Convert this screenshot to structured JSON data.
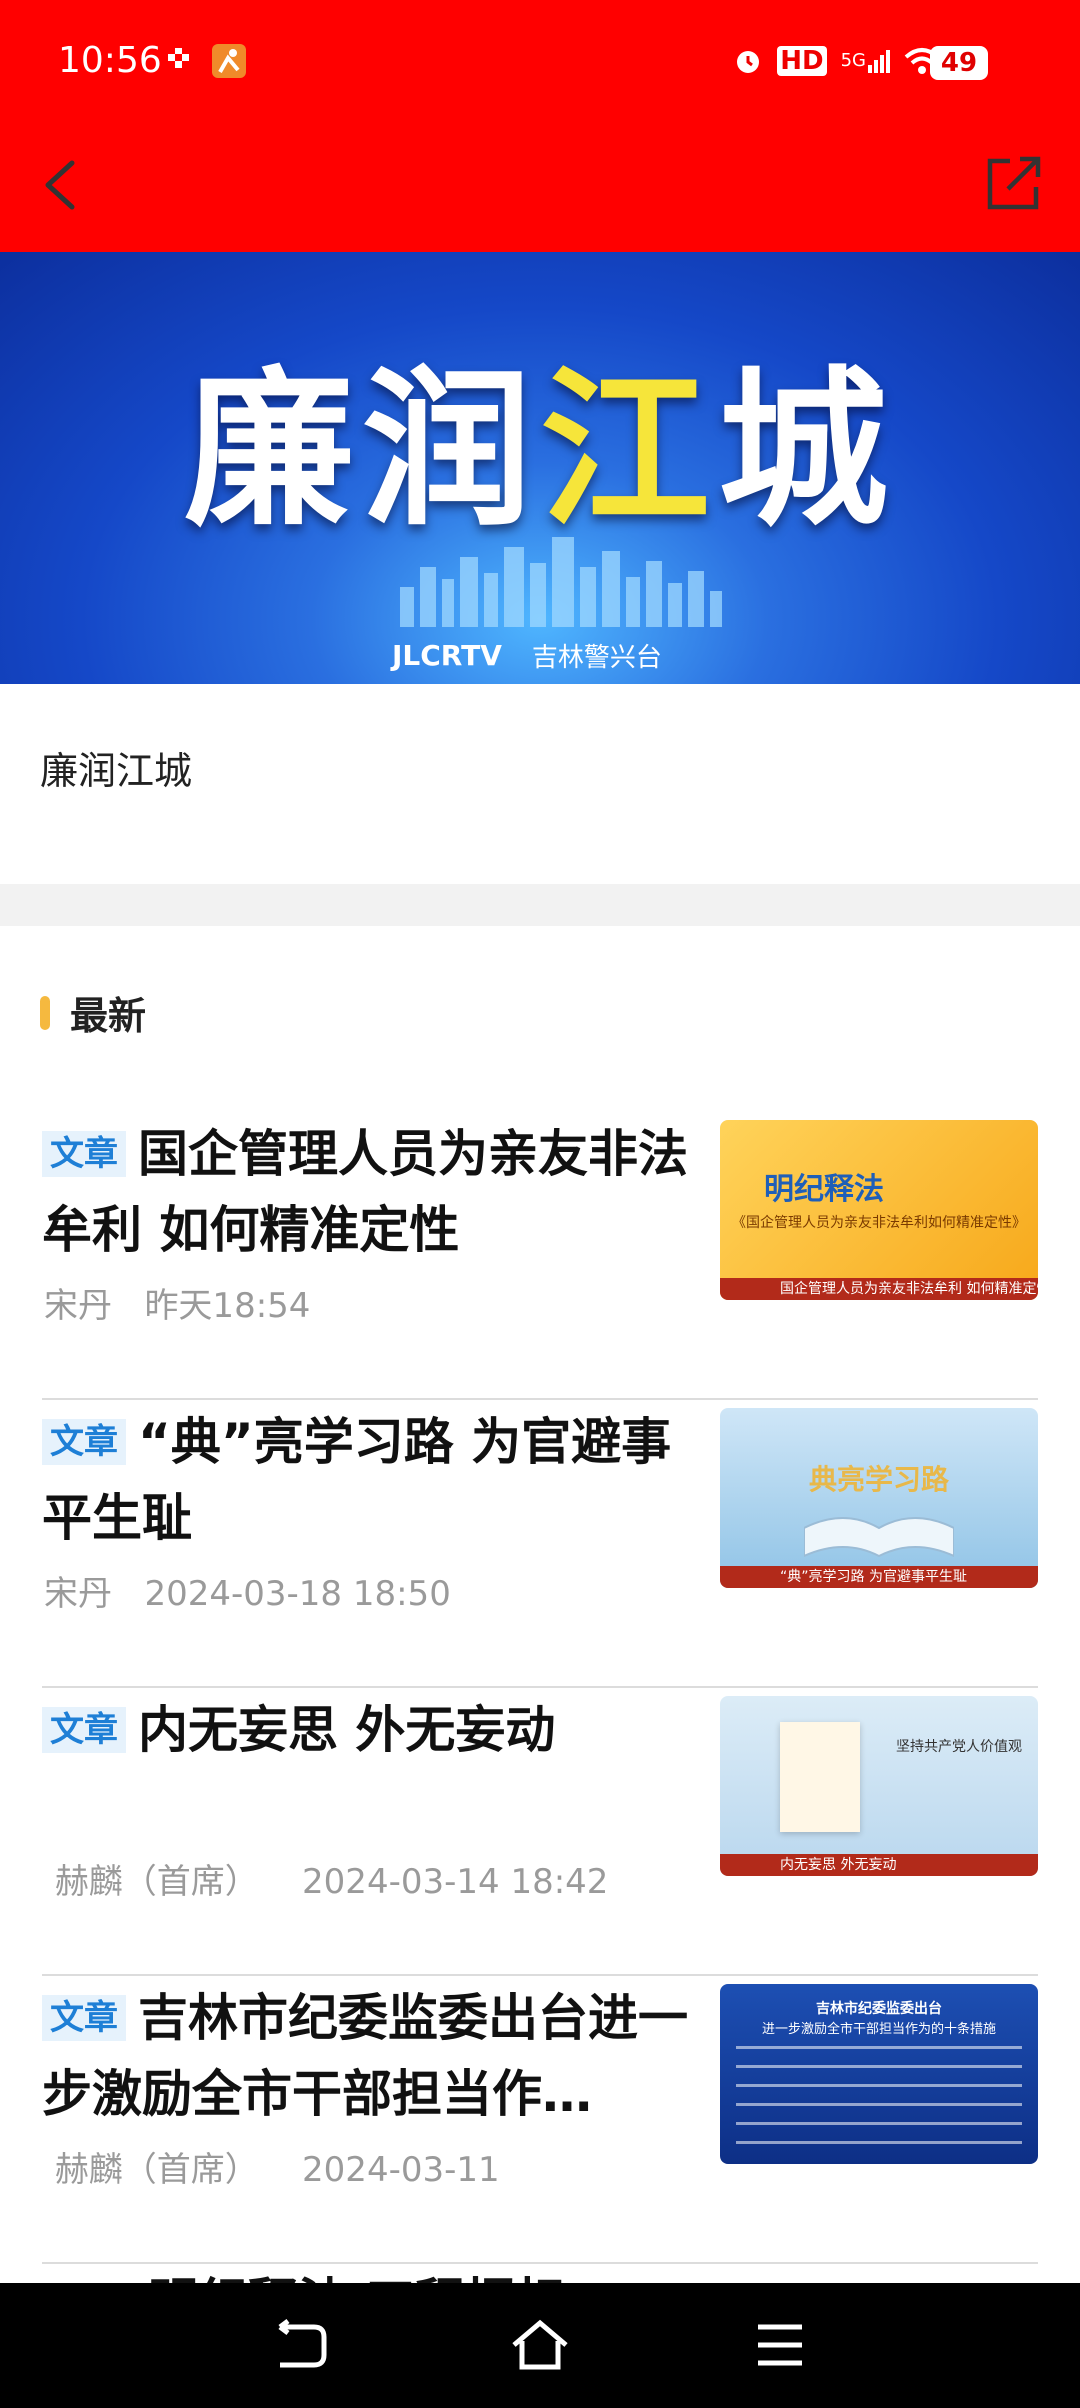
{
  "status": {
    "time": "10:56",
    "network": "5G",
    "hd": "HD",
    "battery": "49"
  },
  "banner": {
    "title_part1": "廉润",
    "title_hl": "江",
    "title_part2": "城",
    "logo_a": "JLCRTV",
    "logo_b": "吉林警兴台"
  },
  "headline": "廉润江城",
  "section": {
    "title": "最新"
  },
  "articles": [
    {
      "tag": "文章",
      "title": "国企管理人员为亲友非法牟利 如何精准定性",
      "author": "宋丹",
      "time": "昨天18:54",
      "thumb": {
        "heading": "明纪释法",
        "sub": "《国企管理人员为亲友非法牟利如何精准定性》",
        "caption": "国企管理人员为亲友非法牟利 如何精准定性"
      }
    },
    {
      "tag": "文章",
      "title": "“典”亮学习路 为官避事平生耻",
      "author": "宋丹",
      "time": "2024-03-18 18:50",
      "thumb": {
        "heading": "典亮学习路",
        "caption": "“典”亮学习路 为官避事平生耻"
      }
    },
    {
      "tag": "文章",
      "title": "内无妄思 外无妄动",
      "author": "赫麟（首席）",
      "time": "2024-03-14 18:42",
      "thumb": {
        "heading": "坚持共产党人价值观",
        "caption": "内无妄思 外无妄动"
      }
    },
    {
      "tag": "文章",
      "title": "吉林市纪委监委出台进一步激励全市干部担当作…",
      "author": "赫麟（首席）",
      "time": "2024-03-11",
      "thumb": {
        "heading": "吉林市纪委监委出台",
        "sub": "进一步激励全市干部担当作为的十条措施"
      }
    }
  ],
  "partial_article": {
    "title": "明纪释法 工程招标"
  },
  "colors": {
    "accent": "#ff0000",
    "tag_bg": "#e6f2fc",
    "tag_text": "#1e7fd6",
    "section_bar": "#f5b93f"
  }
}
